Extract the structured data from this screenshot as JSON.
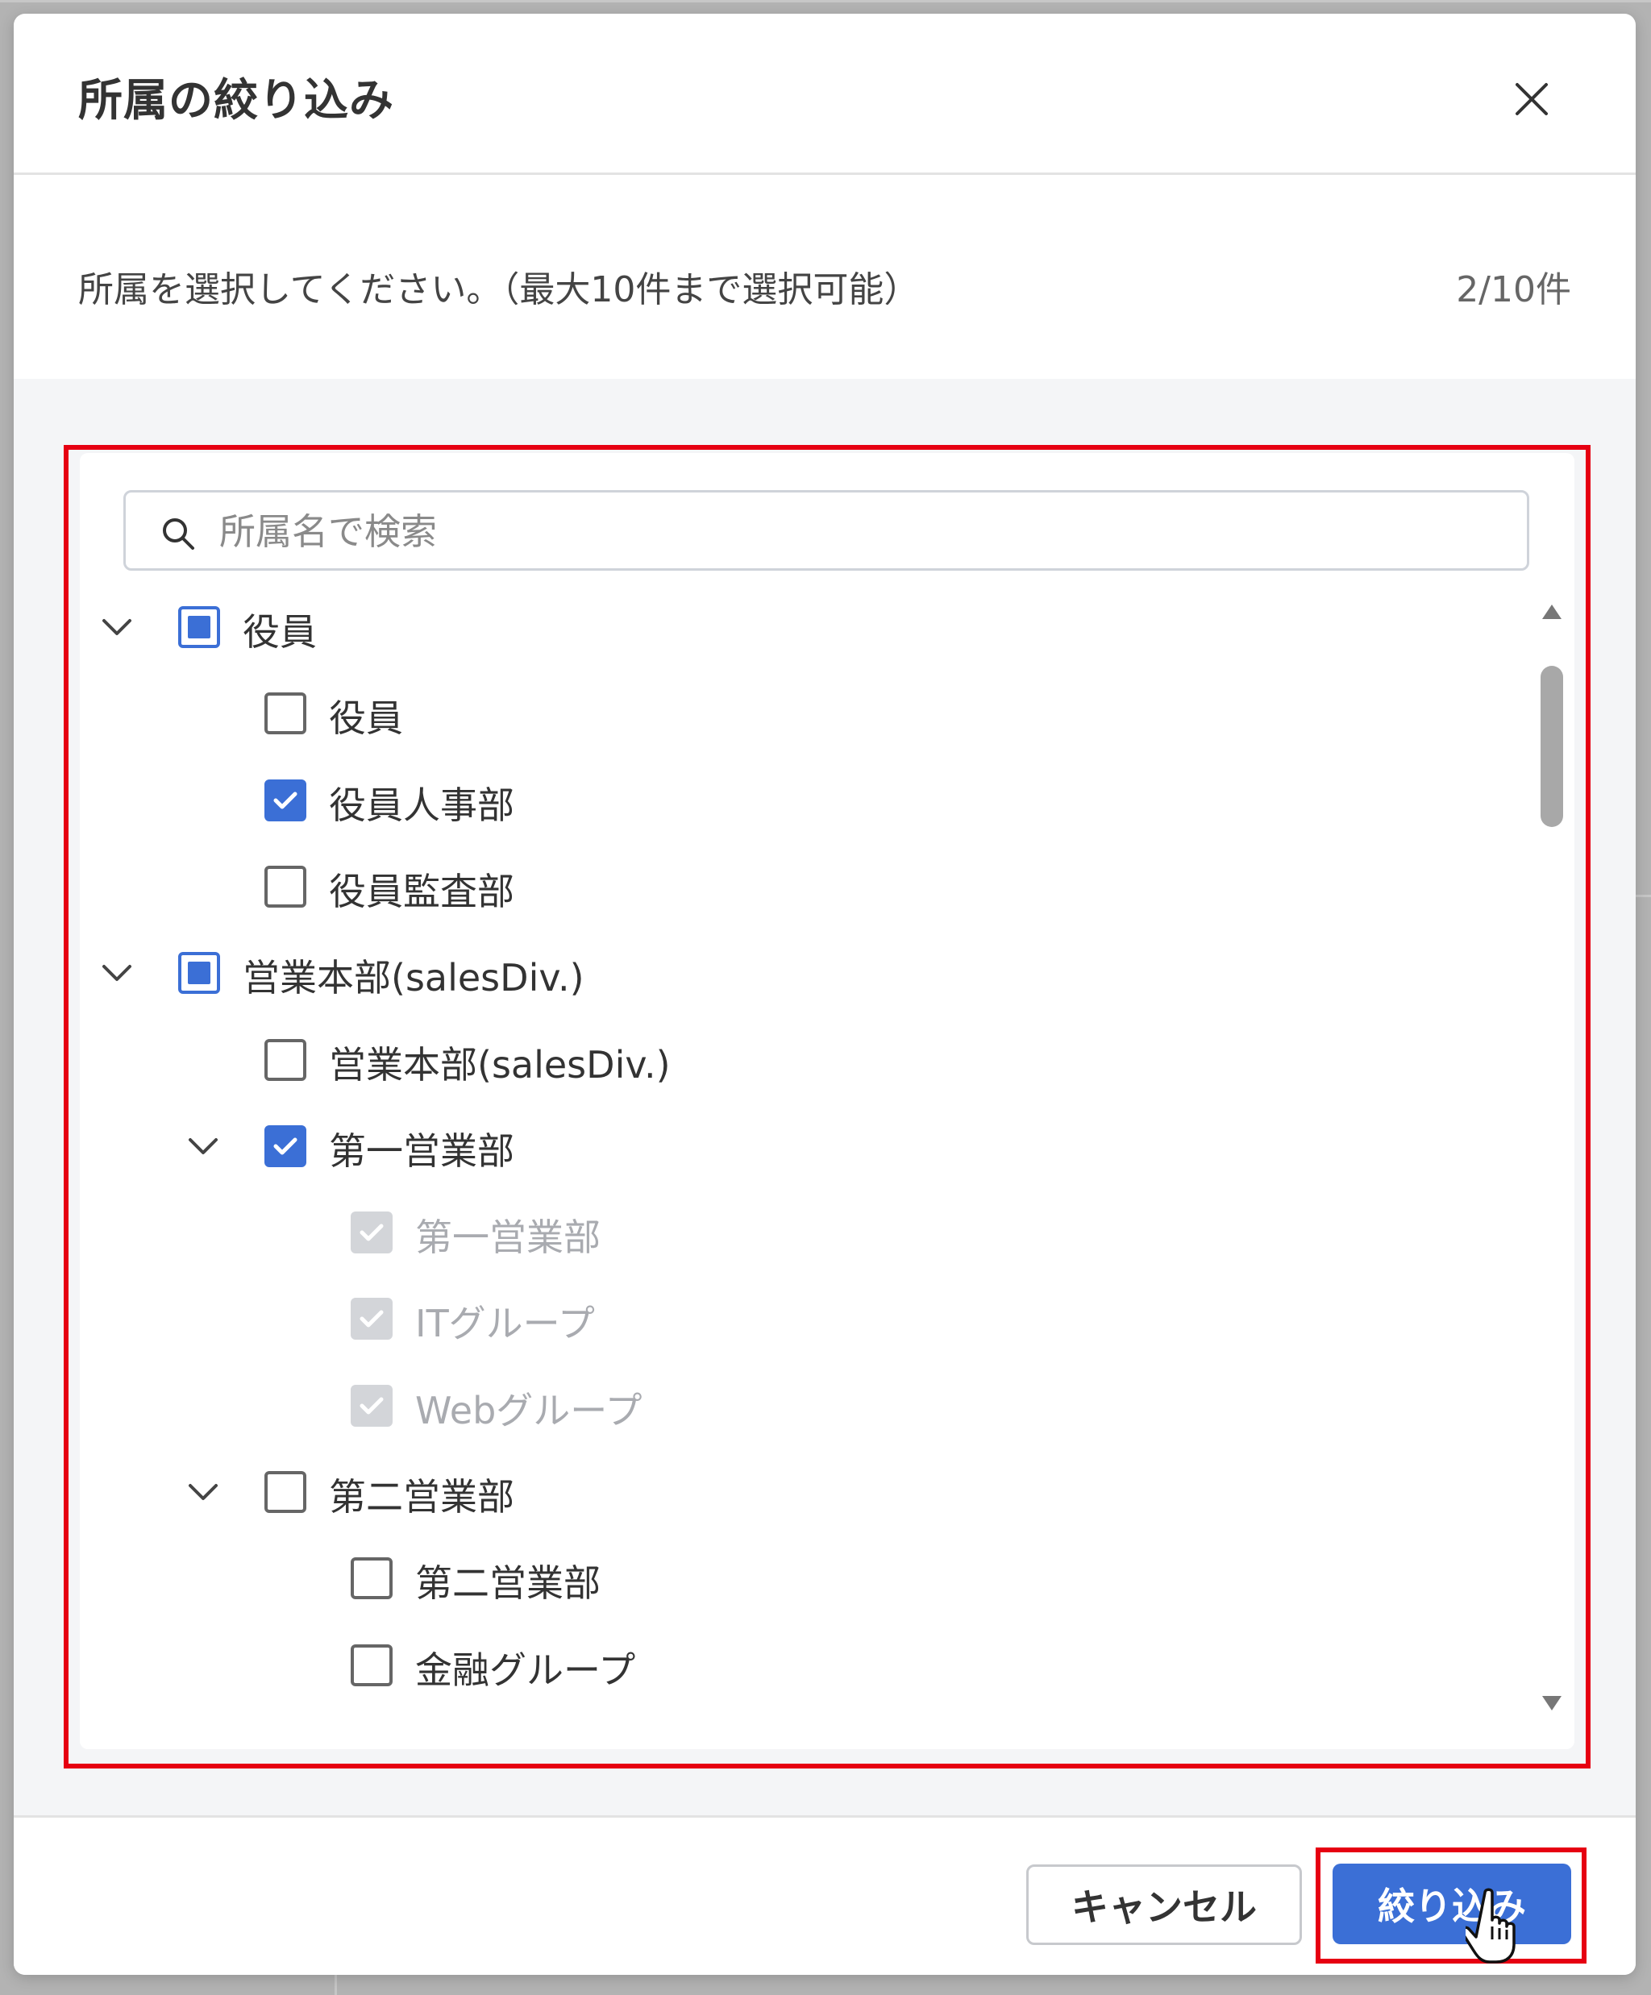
{
  "dialog": {
    "title": "所属の絞り込み",
    "instruction": "所属を選択してください。（最大10件まで選択可能）",
    "count": "2/10件"
  },
  "search": {
    "placeholder": "所属名で検索",
    "value": ""
  },
  "tree": [
    {
      "label": "役員",
      "state": "partial",
      "expanded": true,
      "disabled": false
    },
    {
      "label": "役員",
      "state": "unchecked",
      "disabled": false
    },
    {
      "label": "役員人事部",
      "state": "checked",
      "disabled": false
    },
    {
      "label": "役員監査部",
      "state": "unchecked",
      "disabled": false
    },
    {
      "label": "営業本部(salesDiv.)",
      "state": "partial",
      "expanded": true,
      "disabled": false
    },
    {
      "label": "営業本部(salesDiv.)",
      "state": "unchecked",
      "disabled": false
    },
    {
      "label": "第一営業部",
      "state": "checked",
      "expanded": true,
      "disabled": false
    },
    {
      "label": "第一営業部",
      "state": "checked",
      "disabled": true
    },
    {
      "label": "ITグループ",
      "state": "checked",
      "disabled": true
    },
    {
      "label": "Webグループ",
      "state": "checked",
      "disabled": true
    },
    {
      "label": "第二営業部",
      "state": "unchecked",
      "expanded": true,
      "disabled": false
    },
    {
      "label": "第二営業部",
      "state": "unchecked",
      "disabled": false
    },
    {
      "label": "金融グループ",
      "state": "unchecked",
      "disabled": false
    }
  ],
  "footer": {
    "cancel_label": "キャンセル",
    "apply_label": "絞り込み"
  },
  "colors": {
    "accent": "#3b6fd6",
    "highlight": "#e60012",
    "disabled": "#d3d5d9"
  },
  "icons": [
    "close-icon",
    "search-icon",
    "chevron-down-icon",
    "checkmark-icon",
    "scroll-up-arrow-icon",
    "scroll-down-arrow-icon",
    "hand-cursor-icon"
  ]
}
